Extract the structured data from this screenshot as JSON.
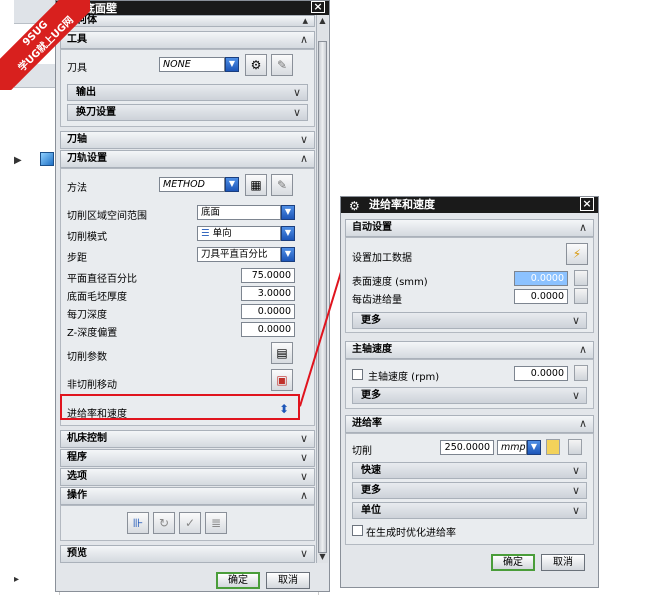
{
  "watermark": {
    "line1": "9SUG",
    "line2": "学UG就上UG网"
  },
  "left_dialog": {
    "title": "底面壁",
    "cut_header": "几何体",
    "tool_section": {
      "header": "工具",
      "tool_label": "刀具",
      "tool_value": "NONE",
      "output": "输出",
      "tool_change": "换刀设置"
    },
    "axis_section": {
      "header": "刀轴"
    },
    "path_section": {
      "header": "刀轨设置",
      "method_label": "方法",
      "method_value": "METHOD",
      "cut_region_label": "切削区域空间范围",
      "cut_region_value": "底面",
      "cut_mode_label": "切削模式",
      "cut_mode_value": "单向",
      "stepover_label": "步距",
      "stepover_value": "刀具平直百分比",
      "flat_pct_label": "平面直径百分比",
      "flat_pct_value": "75.0000",
      "floor_stock_label": "底面毛坯厚度",
      "floor_stock_value": "3.0000",
      "depth_label": "每刀深度",
      "depth_value": "0.0000",
      "zdepth_label": "Z-深度偏置",
      "zdepth_value": "0.0000",
      "cut_params_label": "切削参数",
      "noncut_label": "非切削移动",
      "feeds_label": "进给率和速度"
    },
    "machine_control": "机床控制",
    "program": "程序",
    "options": "选项",
    "actions": "操作",
    "preview": "预览",
    "ok": "确定",
    "cancel": "取消"
  },
  "right_dialog": {
    "title": "进给率和速度",
    "auto_section": {
      "header": "自动设置",
      "set_data_label": "设置加工数据",
      "surface_speed_label": "表面速度 (smm)",
      "surface_speed_value": "0.0000",
      "feed_per_tooth_label": "每齿进给量",
      "feed_per_tooth_value": "0.0000",
      "more": "更多"
    },
    "spindle_section": {
      "header": "主轴速度",
      "spindle_label": "主轴速度 (rpm)",
      "spindle_value": "0.0000",
      "more": "更多"
    },
    "feed_section": {
      "header": "进给率",
      "cut_label": "切削",
      "cut_value": "250.0000",
      "unit_value": "mmp",
      "rapid": "快速",
      "more": "更多",
      "units": "单位",
      "optimize_label": "在生成时优化进给率"
    },
    "ok": "确定",
    "cancel": "取消"
  },
  "colors": {
    "highlight": "#e0141e",
    "title_bg": "#1a1a1a",
    "panel_bg": "#e3e6ea"
  }
}
